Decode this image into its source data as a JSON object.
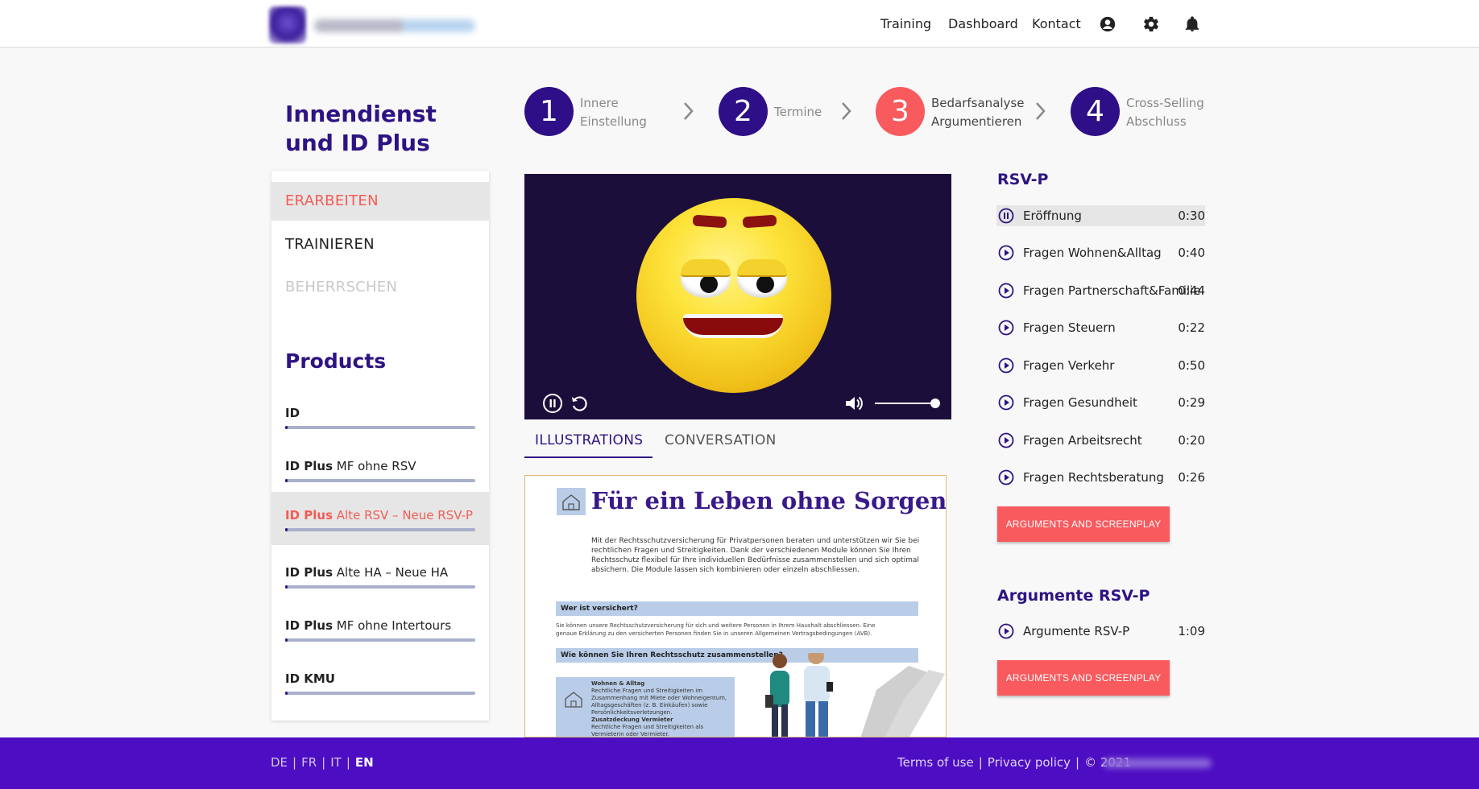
{
  "header": {
    "nav": [
      "Training",
      "Dashboard",
      "Kontact"
    ],
    "icons": [
      "account-icon",
      "settings-icon",
      "notifications-icon"
    ]
  },
  "sidebar": {
    "course_title": "Innendienst und ID Plus",
    "modes": [
      {
        "label": "ERARBEITEN",
        "state": "active"
      },
      {
        "label": "TRAINIEREN",
        "state": "normal"
      },
      {
        "label": "BEHERRSCHEN",
        "state": "disabled"
      }
    ],
    "products_title": "Products",
    "products": [
      {
        "bold": "ID",
        "rest": "",
        "progress": 0.01
      },
      {
        "bold": "ID Plus",
        "rest": " MF ohne RSV",
        "progress": 0.01
      },
      {
        "bold": "ID Plus",
        "rest": " Alte RSV – Neue RSV-P",
        "progress": 0.01,
        "active": true
      },
      {
        "bold": "ID Plus",
        "rest": " Alte HA – Neue HA",
        "progress": 0.01
      },
      {
        "bold": "ID Plus",
        "rest": " MF ohne Intertours",
        "progress": 0.01
      },
      {
        "bold": "ID KMU",
        "rest": "",
        "progress": 0.01
      }
    ]
  },
  "steps": [
    {
      "number": "1",
      "line1": "Innere",
      "line2": "Einstellung",
      "color": "#2e0f87",
      "current": false
    },
    {
      "number": "2",
      "line1": "Termine",
      "line2": "",
      "color": "#2e0f87",
      "current": false
    },
    {
      "number": "3",
      "line1": "Bedarfsanalyse",
      "line2": "Argumentieren",
      "color": "#f85a5e",
      "current": true
    },
    {
      "number": "4",
      "line1": "Cross-Selling",
      "line2": "Abschluss",
      "color": "#2e0f87",
      "current": false
    }
  ],
  "player": {
    "volume": 1.0,
    "controls": [
      "pause-icon",
      "replay-icon",
      "volume-icon"
    ]
  },
  "tabs": [
    {
      "label": "ILLUSTRATIONS",
      "active": true
    },
    {
      "label": "CONVERSATION",
      "active": false
    }
  ],
  "illustration": {
    "title": "Für ein Leben ohne Sorgen",
    "intro": "Mit der Rechtsschutzversicherung für Privatpersonen beraten und unterstützen wir Sie bei rechtlichen Fragen und Streitigkeiten. Dank der verschiedenen Module können Sie Ihren Rechtsschutz flexibel für Ihre individuellen Bedürfnisse zusammenstellen und sich optimal absichern. Die Module lassen sich kombinieren oder einzeln abschliessen.",
    "band1": "Wer ist versichert?",
    "band1_text": "Sie können unsere Rechtsschutzversicherung für sich und weitere Personen in Ihrem Haushalt abschliessen. Eine genaue Erklärung zu den versicherten Personen finden Sie in unseren Allgemeinen Vertragsbedingungen (AVB).",
    "band2": "Wie können Sie Ihren Rechtsschutz zusammenstellen?",
    "box_title1": "Wohnen & Alltag",
    "box_text1": "Rechtliche Fragen und Streitigkeiten im Zusammenhang mit Miete oder Wohneigentum, Alltagsgeschäften (z. B. Einkäufen) sowie Persönlichkeitsverletzungen.",
    "box_title2": "Zusatzdeckung Vermieter",
    "box_text2": "Rechtliche Fragen und Streitigkeiten als Vermieterin oder Vermieter."
  },
  "playlist1": {
    "title": "RSV-P",
    "items": [
      {
        "title": "Eröffnung",
        "duration": "0:30",
        "playing": true
      },
      {
        "title": "Fragen Wohnen&Alltag",
        "duration": "0:40"
      },
      {
        "title": "Fragen Partnerschaft&Familie",
        "duration": "0:44"
      },
      {
        "title": "Fragen Steuern",
        "duration": "0:22"
      },
      {
        "title": "Fragen Verkehr",
        "duration": "0:50"
      },
      {
        "title": "Fragen Gesundheit",
        "duration": "0:29"
      },
      {
        "title": "Fragen Arbeitsrecht",
        "duration": "0:20"
      },
      {
        "title": "Fragen Rechtsberatung",
        "duration": "0:26"
      }
    ],
    "button": "ARGUMENTS AND SCREENPLAY"
  },
  "playlist2": {
    "title": "Argumente RSV-P",
    "items": [
      {
        "title": "Argumente RSV-P",
        "duration": "1:09"
      }
    ],
    "button": "ARGUMENTS AND SCREENPLAY"
  },
  "footer": {
    "languages": [
      {
        "code": "DE",
        "selected": false
      },
      {
        "code": "FR",
        "selected": false
      },
      {
        "code": "IT",
        "selected": false
      },
      {
        "code": "EN",
        "selected": true
      }
    ],
    "terms": "Terms of use",
    "privacy": "Privacy policy",
    "copyright": "© 2021"
  },
  "colors": {
    "brand": "#2e1383",
    "accent": "#f85a5e",
    "footer": "#4d0dc2"
  }
}
